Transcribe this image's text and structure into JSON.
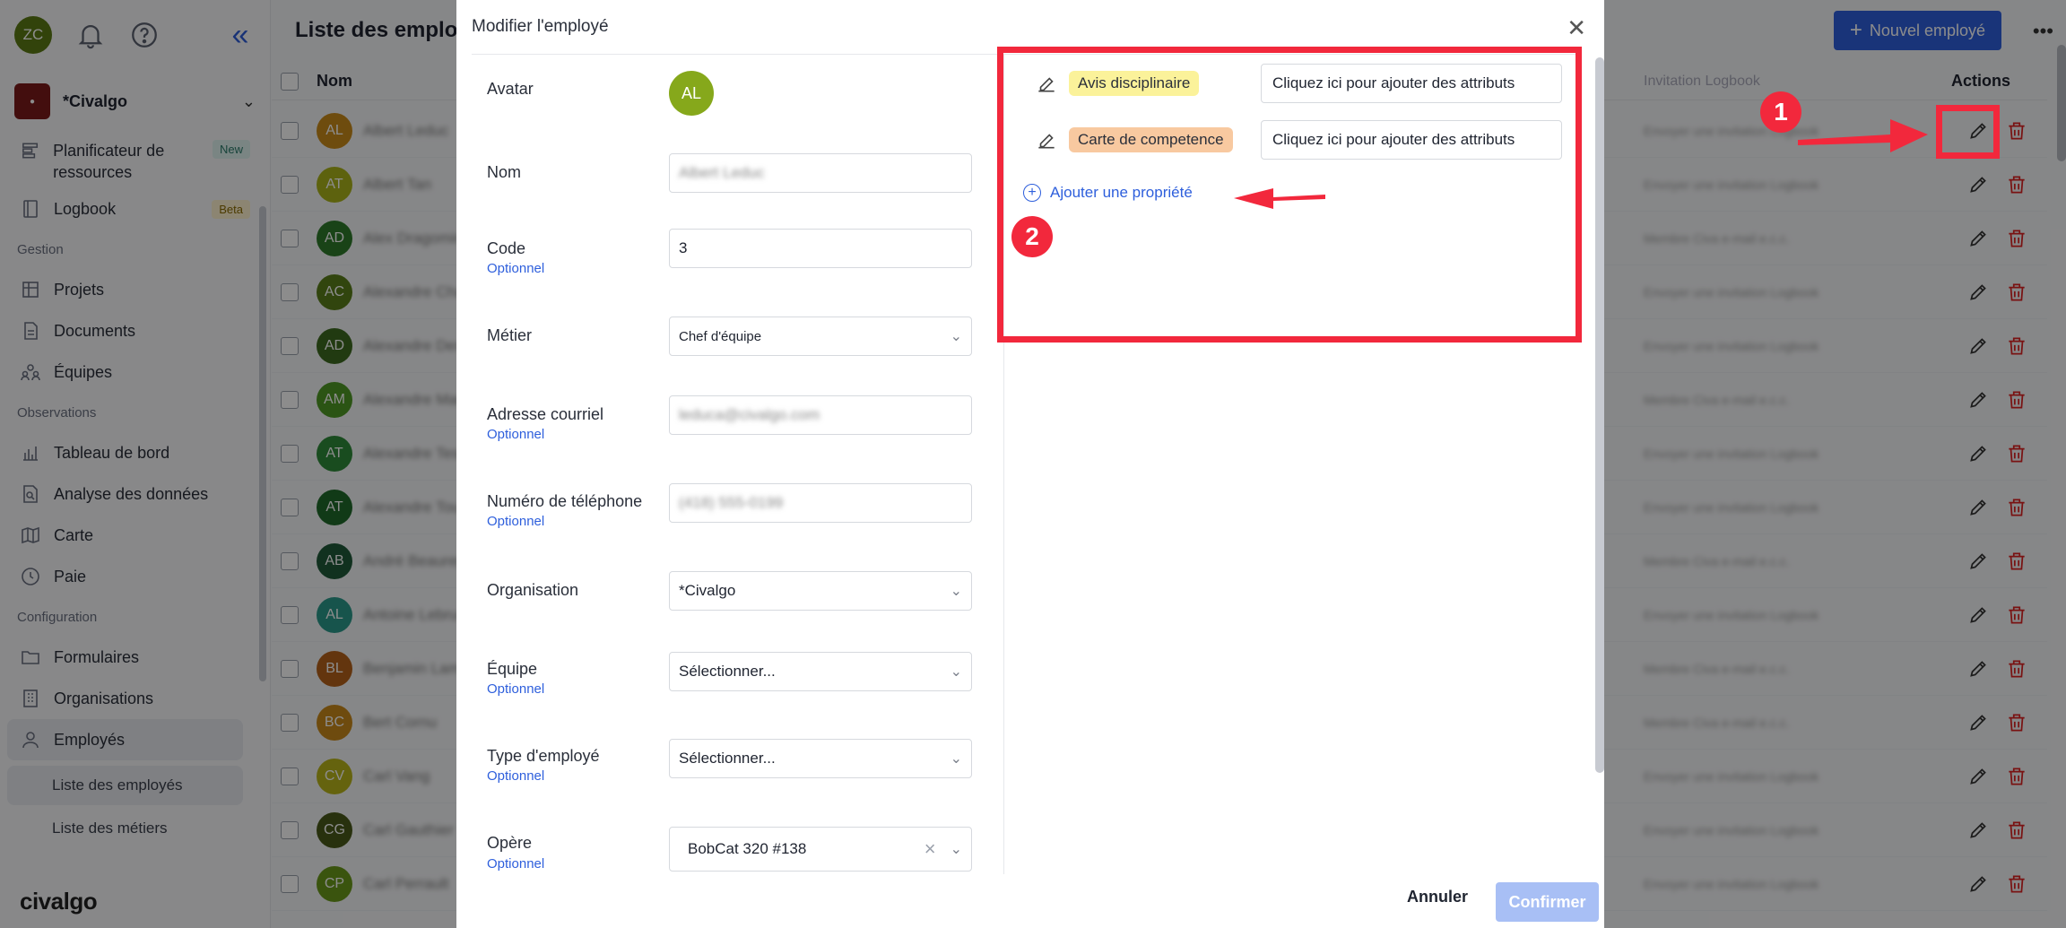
{
  "sidebar": {
    "user_initials": "ZC",
    "org_name": "*Civalgo",
    "items": {
      "planificateur": "Planificateur de ressources",
      "planificateur_badge": "New",
      "logbook": "Logbook",
      "logbook_badge": "Beta",
      "section_gestion": "Gestion",
      "projets": "Projets",
      "documents": "Documents",
      "equipes": "Équipes",
      "section_observations": "Observations",
      "tableau": "Tableau de bord",
      "analyse": "Analyse des données",
      "carte": "Carte",
      "paie": "Paie",
      "section_config": "Configuration",
      "formulaires": "Formulaires",
      "organisations": "Organisations",
      "employes": "Employés",
      "liste_employes": "Liste des employés",
      "liste_metiers": "Liste des métiers"
    },
    "brand": "civalgo"
  },
  "main": {
    "title": "Liste des employé",
    "new_button": "Nouvel employé",
    "col_nom": "Nom",
    "col_access": "Invitation Logbook",
    "col_actions": "Actions",
    "rows": [
      {
        "initials": "AL",
        "color": "#c98a1a",
        "name": "Albert Leduc",
        "access": "Envoyer une invitation Logbook"
      },
      {
        "initials": "AT",
        "color": "#a9b21a",
        "name": "Albert Tan",
        "access": "Envoyer une invitation Logbook"
      },
      {
        "initials": "AD",
        "color": "#2f7a2a",
        "name": "Alex Dragomir",
        "access": "Membre Civa e-mail e.c.c."
      },
      {
        "initials": "AC",
        "color": "#5a7f1a",
        "name": "Alexandre Chab",
        "access": "Envoyer une invitation Logbook"
      },
      {
        "initials": "AD",
        "color": "#3d6b1f",
        "name": "Alexandre Desch",
        "access": "Envoyer une invitation Logbook"
      },
      {
        "initials": "AM",
        "color": "#4f9a25",
        "name": "Alexandre Mart",
        "access": "Membre Civa e-mail e.c.c."
      },
      {
        "initials": "AT",
        "color": "#2f8a3a",
        "name": "Alexandre Tess",
        "access": "Envoyer une invitation Logbook"
      },
      {
        "initials": "AT",
        "color": "#1f6b2a",
        "name": "Alexandre Tour",
        "access": "Envoyer une invitation Logbook"
      },
      {
        "initials": "AB",
        "color": "#1f5a3a",
        "name": "André Beauregard",
        "access": "Membre Civa e-mail e.c.c."
      },
      {
        "initials": "AL",
        "color": "#2a9a8a",
        "name": "Antoine Lebrun",
        "access": "Envoyer une invitation Logbook"
      },
      {
        "initials": "BL",
        "color": "#b5621a",
        "name": "Benjamin Lamy",
        "access": "Membre Civa e-mail e.c.c."
      },
      {
        "initials": "BC",
        "color": "#c9891a",
        "name": "Bert Cornu",
        "access": "Membre Civa e-mail e.c.c."
      },
      {
        "initials": "CV",
        "color": "#b9b51a",
        "name": "Carl Vang",
        "access": "Envoyer une invitation Logbook"
      },
      {
        "initials": "CG",
        "color": "#4a5a1a",
        "name": "Carl Gauthier",
        "access": "Envoyer une invitation Logbook"
      },
      {
        "initials": "CP",
        "color": "#6a9a1a",
        "name": "Carl Perrault",
        "access": "Envoyer une invitation Logbook"
      }
    ]
  },
  "modal": {
    "title": "Modifier l'employé",
    "avatar_label": "Avatar",
    "avatar_initials": "AL",
    "optional": "Optionnel",
    "fields": {
      "nom_label": "Nom",
      "nom_value": "Albert Leduc",
      "code_label": "Code",
      "code_value": "3",
      "metier_label": "Métier",
      "metier_value": "Chef d'équipe",
      "email_label": "Adresse courriel",
      "email_value": "leduca@civalgo.com",
      "phone_label": "Numéro de téléphone",
      "phone_value": "(418) 555-0199",
      "org_label": "Organisation",
      "org_value": "*Civalgo",
      "equipe_label": "Équipe",
      "equipe_value": "Sélectionner...",
      "type_label": "Type d'employé",
      "type_value": "Sélectionner...",
      "opere_label": "Opère",
      "opere_value": "BobCat 320 #138"
    },
    "attributes": [
      {
        "tag": "Avis disciplinaire",
        "tag_color": "#fbf29a",
        "placeholder": "Cliquez ici pour ajouter des attributs"
      },
      {
        "tag": "Carte de competence",
        "tag_color": "#f8c9a0",
        "placeholder": "Cliquez ici pour ajouter des attributs"
      }
    ],
    "add_property": "Ajouter une propriété",
    "cancel": "Annuler",
    "confirm": "Confirmer"
  },
  "annotations": {
    "step1": "1",
    "step2": "2",
    "color": "#f2283c"
  }
}
